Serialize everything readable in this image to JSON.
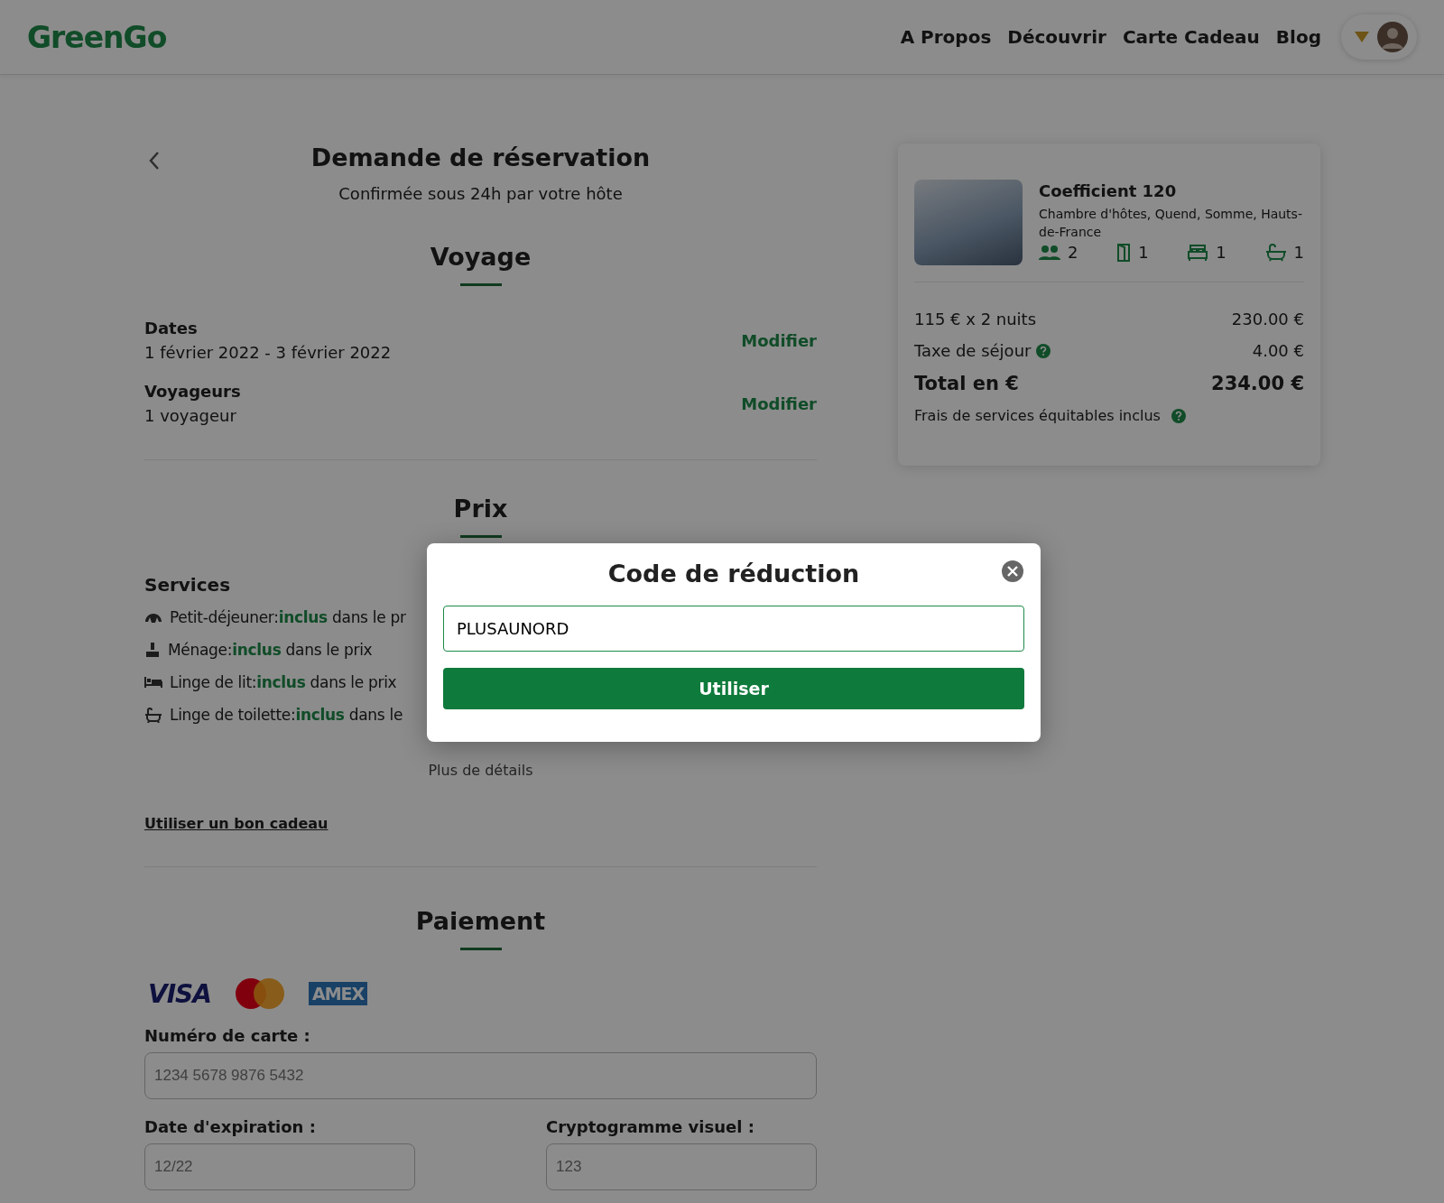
{
  "header": {
    "logo": "GreenGo",
    "nav": [
      "A Propos",
      "Découvrir",
      "Carte Cadeau",
      "Blog"
    ]
  },
  "booking": {
    "title": "Demande de réservation",
    "subtitle": "Confirmée sous 24h par votre hôte"
  },
  "voyage": {
    "heading": "Voyage",
    "fields": [
      {
        "label": "Dates",
        "value": "1 février 2022 - 3 février 2022",
        "action": "Modifier"
      },
      {
        "label": "Voyageurs",
        "value": "1 voyageur",
        "action": "Modifier"
      }
    ]
  },
  "prix": {
    "heading": "Prix",
    "services_heading": "Services",
    "services": [
      {
        "kind": "breakfast",
        "text": "Petit-déjeuner:**inclus** dans le pr"
      },
      {
        "kind": "cleaning",
        "text": "Ménage:**inclus** dans le prix"
      },
      {
        "kind": "bed",
        "text": "Linge de lit:**inclus** dans le prix"
      },
      {
        "kind": "bath",
        "text": "Linge de toilette:**inclus** dans le"
      }
    ],
    "details_link": "Plus de détails",
    "gift_link": "Utiliser un bon cadeau"
  },
  "paiement": {
    "heading": "Paiement",
    "brands": [
      {
        "kind": "visa",
        "label": "VISA"
      },
      {
        "kind": "mastercard"
      },
      {
        "kind": "amex",
        "label": "AMEX"
      }
    ],
    "card_number": {
      "label": "Numéro de carte :",
      "placeholder": "1234 5678 9876 5432"
    },
    "expiry": {
      "label": "Date d'expiration :",
      "placeholder": "12/22"
    },
    "cvv": {
      "label": "Cryptogramme visuel :",
      "placeholder": "123"
    }
  },
  "summary": {
    "title": "Coefficient 120",
    "subtitle": "Chambre d'hôtes, Quend, Somme, Hauts-de-France",
    "capacities": [
      {
        "kind": "people",
        "value": "2"
      },
      {
        "kind": "door",
        "value": "1"
      },
      {
        "kind": "bed",
        "value": "1"
      },
      {
        "kind": "bath",
        "value": "1"
      }
    ],
    "lines": [
      {
        "kind": "normal",
        "label": "115 € x 2 nuits",
        "amount": "230.00 €"
      },
      {
        "kind": "normal",
        "label": "Taxe de séjour",
        "amount": "4.00 €",
        "help": true
      },
      {
        "kind": "total",
        "label": "Total en €",
        "amount": "234.00 €"
      }
    ],
    "note": "Frais de services équitables inclus",
    "note_help": true
  },
  "modal": {
    "title": "Code de réduction",
    "value": "PLUSAUNORD",
    "button": "Utiliser"
  }
}
